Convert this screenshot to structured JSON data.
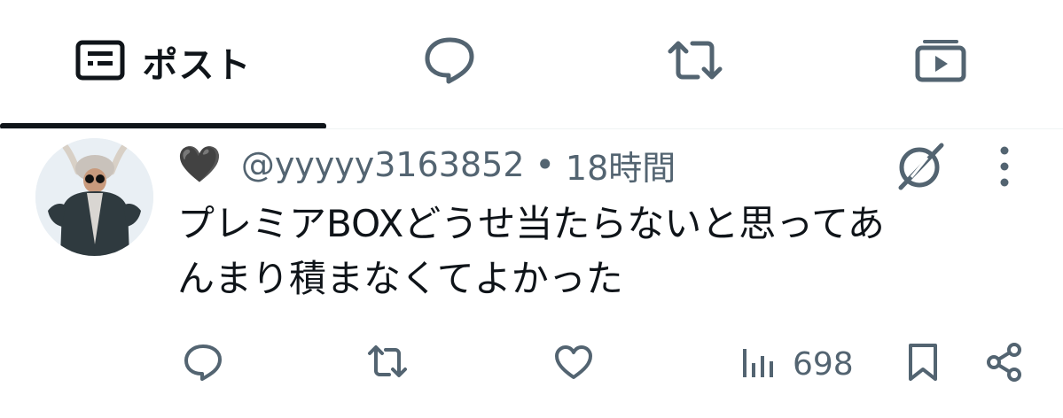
{
  "tabs": [
    {
      "label": "ポスト",
      "icon": "posts-icon",
      "active": true
    },
    {
      "label": "",
      "icon": "reply-icon",
      "active": false
    },
    {
      "label": "",
      "icon": "repost-icon",
      "active": false
    },
    {
      "label": "",
      "icon": "media-icon",
      "active": false
    }
  ],
  "post": {
    "display_name_emoji": "🖤",
    "handle": "@yyyyy3163852",
    "separator": "•",
    "time": "18時間",
    "text_line1": "プレミアBOXどうせ当たらないと思ってあ",
    "text_line2": "んまり積まなくてよかった",
    "views": "698"
  },
  "colors": {
    "primary_text": "#0f1419",
    "secondary_text": "#536471",
    "divider": "#eff3f4"
  },
  "icons": [
    "posts-icon",
    "reply-icon",
    "repost-icon",
    "media-icon",
    "grok-icon",
    "more-icon",
    "reply-icon",
    "repost-icon",
    "like-icon",
    "views-icon",
    "bookmark-icon",
    "share-icon"
  ]
}
